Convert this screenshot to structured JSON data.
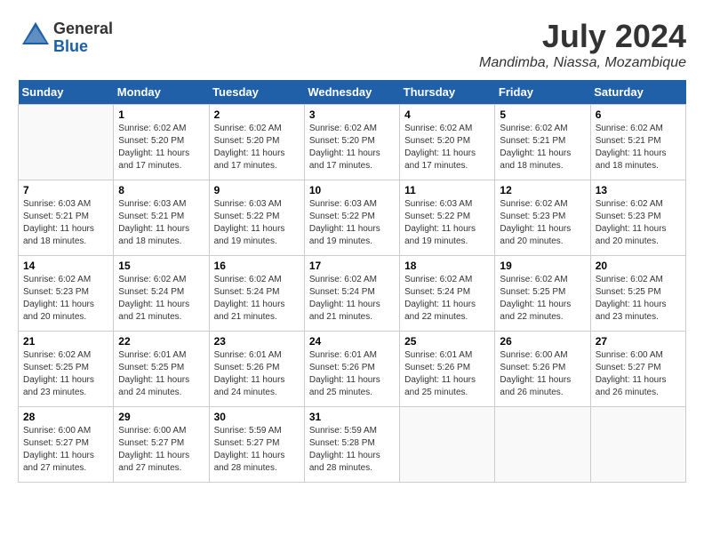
{
  "logo": {
    "general": "General",
    "blue": "Blue"
  },
  "title": "July 2024",
  "subtitle": "Mandimba, Niassa, Mozambique",
  "header": {
    "days": [
      "Sunday",
      "Monday",
      "Tuesday",
      "Wednesday",
      "Thursday",
      "Friday",
      "Saturday"
    ]
  },
  "weeks": [
    {
      "cells": [
        {
          "day": "",
          "info": ""
        },
        {
          "day": "1",
          "info": "Sunrise: 6:02 AM\nSunset: 5:20 PM\nDaylight: 11 hours and 17 minutes."
        },
        {
          "day": "2",
          "info": "Sunrise: 6:02 AM\nSunset: 5:20 PM\nDaylight: 11 hours and 17 minutes."
        },
        {
          "day": "3",
          "info": "Sunrise: 6:02 AM\nSunset: 5:20 PM\nDaylight: 11 hours and 17 minutes."
        },
        {
          "day": "4",
          "info": "Sunrise: 6:02 AM\nSunset: 5:20 PM\nDaylight: 11 hours and 17 minutes."
        },
        {
          "day": "5",
          "info": "Sunrise: 6:02 AM\nSunset: 5:21 PM\nDaylight: 11 hours and 18 minutes."
        },
        {
          "day": "6",
          "info": "Sunrise: 6:02 AM\nSunset: 5:21 PM\nDaylight: 11 hours and 18 minutes."
        }
      ]
    },
    {
      "cells": [
        {
          "day": "7",
          "info": "Sunrise: 6:03 AM\nSunset: 5:21 PM\nDaylight: 11 hours and 18 minutes."
        },
        {
          "day": "8",
          "info": "Sunrise: 6:03 AM\nSunset: 5:21 PM\nDaylight: 11 hours and 18 minutes."
        },
        {
          "day": "9",
          "info": "Sunrise: 6:03 AM\nSunset: 5:22 PM\nDaylight: 11 hours and 19 minutes."
        },
        {
          "day": "10",
          "info": "Sunrise: 6:03 AM\nSunset: 5:22 PM\nDaylight: 11 hours and 19 minutes."
        },
        {
          "day": "11",
          "info": "Sunrise: 6:03 AM\nSunset: 5:22 PM\nDaylight: 11 hours and 19 minutes."
        },
        {
          "day": "12",
          "info": "Sunrise: 6:02 AM\nSunset: 5:23 PM\nDaylight: 11 hours and 20 minutes."
        },
        {
          "day": "13",
          "info": "Sunrise: 6:02 AM\nSunset: 5:23 PM\nDaylight: 11 hours and 20 minutes."
        }
      ]
    },
    {
      "cells": [
        {
          "day": "14",
          "info": "Sunrise: 6:02 AM\nSunset: 5:23 PM\nDaylight: 11 hours and 20 minutes."
        },
        {
          "day": "15",
          "info": "Sunrise: 6:02 AM\nSunset: 5:24 PM\nDaylight: 11 hours and 21 minutes."
        },
        {
          "day": "16",
          "info": "Sunrise: 6:02 AM\nSunset: 5:24 PM\nDaylight: 11 hours and 21 minutes."
        },
        {
          "day": "17",
          "info": "Sunrise: 6:02 AM\nSunset: 5:24 PM\nDaylight: 11 hours and 21 minutes."
        },
        {
          "day": "18",
          "info": "Sunrise: 6:02 AM\nSunset: 5:24 PM\nDaylight: 11 hours and 22 minutes."
        },
        {
          "day": "19",
          "info": "Sunrise: 6:02 AM\nSunset: 5:25 PM\nDaylight: 11 hours and 22 minutes."
        },
        {
          "day": "20",
          "info": "Sunrise: 6:02 AM\nSunset: 5:25 PM\nDaylight: 11 hours and 23 minutes."
        }
      ]
    },
    {
      "cells": [
        {
          "day": "21",
          "info": "Sunrise: 6:02 AM\nSunset: 5:25 PM\nDaylight: 11 hours and 23 minutes."
        },
        {
          "day": "22",
          "info": "Sunrise: 6:01 AM\nSunset: 5:25 PM\nDaylight: 11 hours and 24 minutes."
        },
        {
          "day": "23",
          "info": "Sunrise: 6:01 AM\nSunset: 5:26 PM\nDaylight: 11 hours and 24 minutes."
        },
        {
          "day": "24",
          "info": "Sunrise: 6:01 AM\nSunset: 5:26 PM\nDaylight: 11 hours and 25 minutes."
        },
        {
          "day": "25",
          "info": "Sunrise: 6:01 AM\nSunset: 5:26 PM\nDaylight: 11 hours and 25 minutes."
        },
        {
          "day": "26",
          "info": "Sunrise: 6:00 AM\nSunset: 5:26 PM\nDaylight: 11 hours and 26 minutes."
        },
        {
          "day": "27",
          "info": "Sunrise: 6:00 AM\nSunset: 5:27 PM\nDaylight: 11 hours and 26 minutes."
        }
      ]
    },
    {
      "cells": [
        {
          "day": "28",
          "info": "Sunrise: 6:00 AM\nSunset: 5:27 PM\nDaylight: 11 hours and 27 minutes."
        },
        {
          "day": "29",
          "info": "Sunrise: 6:00 AM\nSunset: 5:27 PM\nDaylight: 11 hours and 27 minutes."
        },
        {
          "day": "30",
          "info": "Sunrise: 5:59 AM\nSunset: 5:27 PM\nDaylight: 11 hours and 28 minutes."
        },
        {
          "day": "31",
          "info": "Sunrise: 5:59 AM\nSunset: 5:28 PM\nDaylight: 11 hours and 28 minutes."
        },
        {
          "day": "",
          "info": ""
        },
        {
          "day": "",
          "info": ""
        },
        {
          "day": "",
          "info": ""
        }
      ]
    }
  ]
}
